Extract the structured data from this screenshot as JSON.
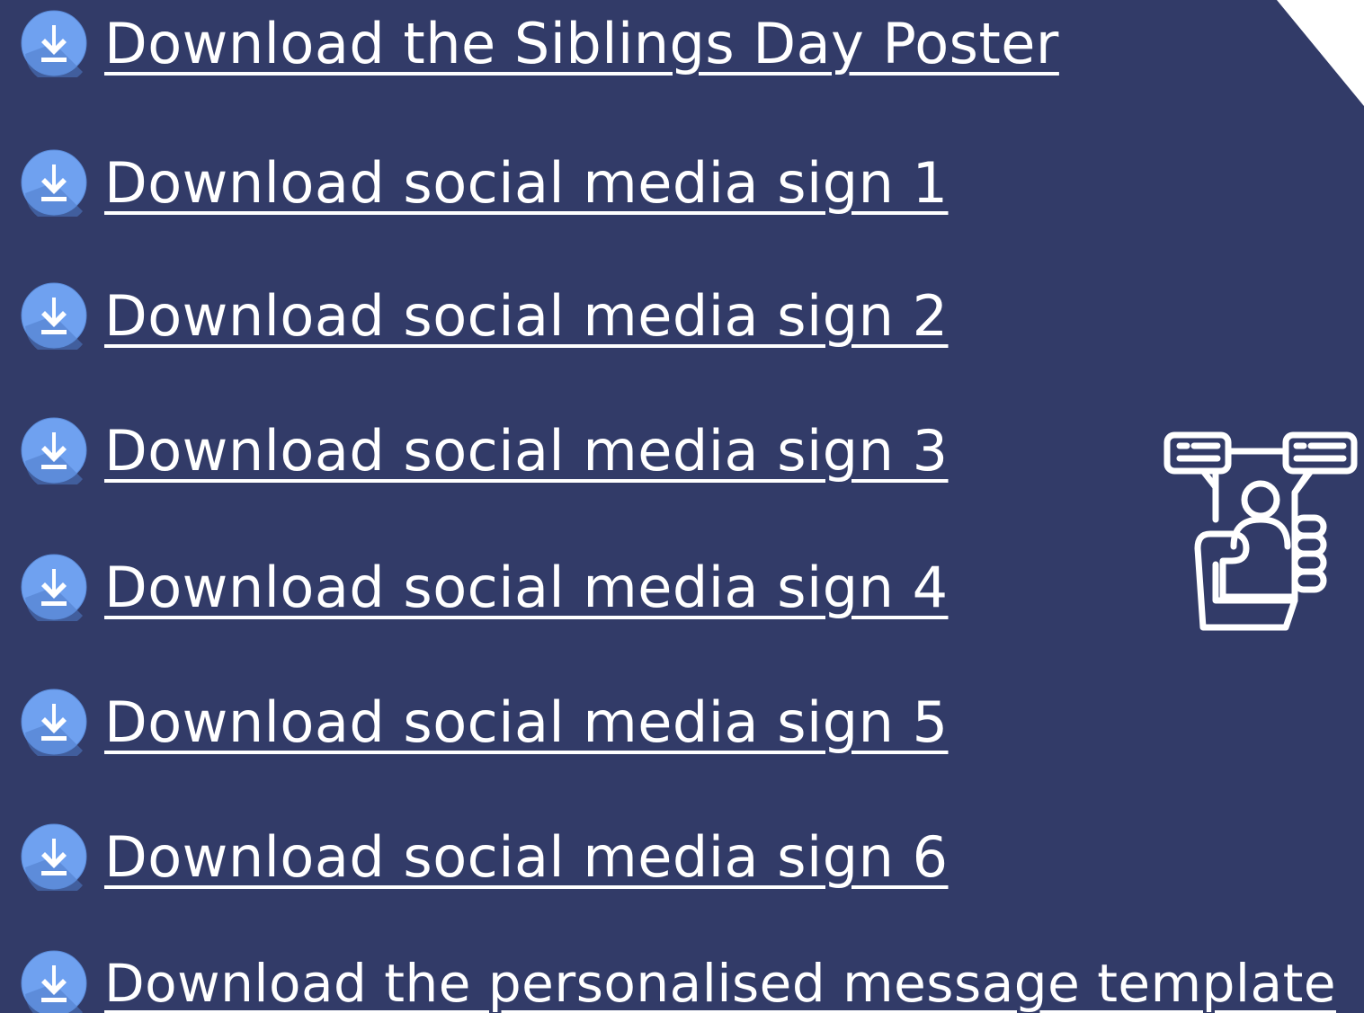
{
  "colors": {
    "panel_background": "#323b68",
    "link_text": "#ffffff",
    "icon_circle": "#6fa1f0",
    "icon_shadow": "#4f7cc9",
    "icon_glyph": "#ffffff"
  },
  "downloads": [
    {
      "label": "Download the Siblings Day Poster",
      "icon": "download-icon"
    },
    {
      "label": "Download social media sign 1",
      "icon": "download-icon"
    },
    {
      "label": "Download social media sign 2 ",
      "icon": "download-icon"
    },
    {
      "label": "Download social media sign 3",
      "icon": "download-icon"
    },
    {
      "label": "Download social media sign 4",
      "icon": "download-icon"
    },
    {
      "label": "Download social media sign 5",
      "icon": "download-icon"
    },
    {
      "label": "Download social media sign 6",
      "icon": "download-icon"
    },
    {
      "label": "Download the personalised message template",
      "icon": "download-icon"
    }
  ],
  "illustration": {
    "icon": "social-media-phone-chat-icon"
  }
}
